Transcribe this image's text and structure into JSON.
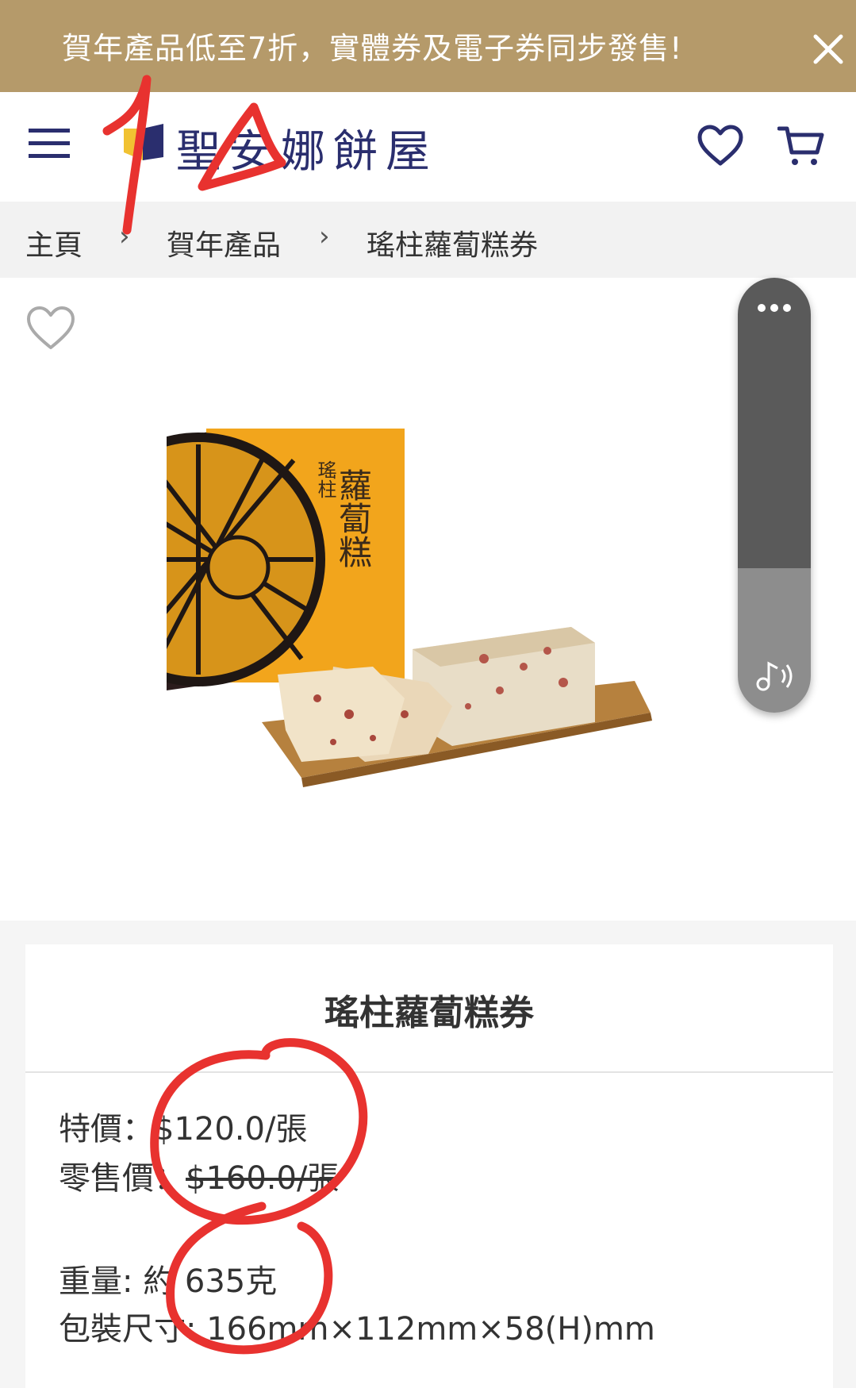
{
  "promo": {
    "text": "賀年產品低至7折，實體券及電子券同步發售!"
  },
  "header": {
    "brand": "聖安娜餅屋"
  },
  "breadcrumb": {
    "items": [
      "主頁",
      "賀年產品",
      "瑤柱蘿蔔糕券"
    ]
  },
  "product": {
    "image_box_text": {
      "small": "瑤柱",
      "main": "蘿蔔糕"
    },
    "name": "瑤柱蘿蔔糕券",
    "special_label": "特價：",
    "special_price": "$120.0/張",
    "retail_label": "零售價：",
    "retail_price": "$160.0/張",
    "weight": "重量: 約 635克",
    "package_size": "包裝尺寸: 166mm×112mm×58(H)mm"
  },
  "colors": {
    "promo_bg": "#b59a6a",
    "brand_navy": "#2a2e6e",
    "annotation_red": "#e8322f"
  },
  "icons": [
    "close-icon",
    "hamburger-icon",
    "heart-icon",
    "cart-icon",
    "more-icon",
    "sound-icon"
  ]
}
